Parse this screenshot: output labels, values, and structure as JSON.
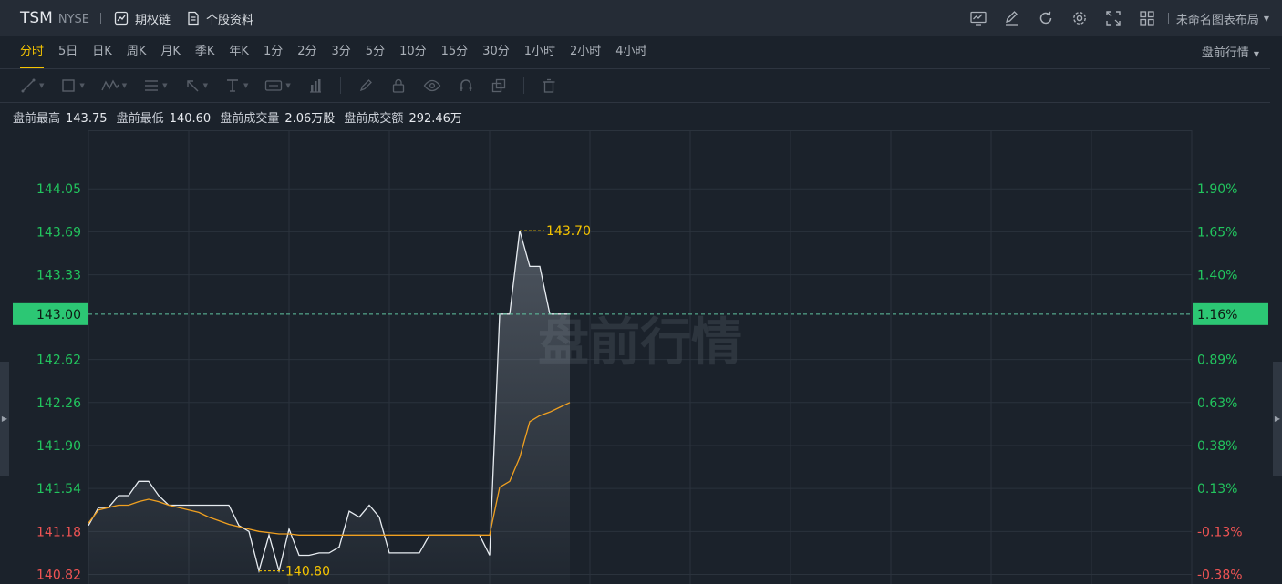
{
  "header": {
    "symbol": "TSM",
    "exchange": "NYSE",
    "btn_options": "期权链",
    "btn_profile": "个股资料",
    "layout_name": "未命名图表布局"
  },
  "header_icons": [
    "indicator-icon",
    "edit-icon",
    "refresh-icon",
    "settings-icon",
    "fullscreen-icon",
    "grid-layout-icon"
  ],
  "periods": [
    "分时",
    "5日",
    "日K",
    "周K",
    "月K",
    "季K",
    "年K",
    "1分",
    "2分",
    "3分",
    "5分",
    "10分",
    "15分",
    "30分",
    "1小时",
    "2小时",
    "4小时"
  ],
  "active_period": "分时",
  "session_label": "盘前行情",
  "draw_tools": [
    "trend-line-icon",
    "rectangle-icon",
    "pattern-icon",
    "fib-icon",
    "arrow-icon",
    "text-icon",
    "price-label-icon",
    "bar-pattern-icon",
    "brush-icon",
    "lock-icon",
    "eye-icon",
    "magnet-icon",
    "clone-icon",
    "trash-icon"
  ],
  "stats": [
    {
      "label": "盘前最高",
      "value": "143.75"
    },
    {
      "label": "盘前最低",
      "value": "140.60"
    },
    {
      "label": "盘前成交量",
      "value": "2.06万股"
    },
    {
      "label": "盘前成交额",
      "value": "292.46万"
    }
  ],
  "colors": {
    "up": "#22c55e",
    "down": "#f05454",
    "current_bg": "#2cc774",
    "price_line": "#e8edf2",
    "avg_line": "#f0a020",
    "annotation": "#f5c400",
    "watermark": "#3a424c"
  },
  "chart_data": {
    "type": "line",
    "watermark": "盘前行情",
    "y_ticks": [
      {
        "price": "144.05",
        "pct": "1.90%",
        "dir": "up"
      },
      {
        "price": "143.69",
        "pct": "1.65%",
        "dir": "up"
      },
      {
        "price": "143.33",
        "pct": "1.40%",
        "dir": "up"
      },
      {
        "price": "142.62",
        "pct": "0.89%",
        "dir": "up"
      },
      {
        "price": "142.26",
        "pct": "0.63%",
        "dir": "up"
      },
      {
        "price": "141.90",
        "pct": "0.38%",
        "dir": "up"
      },
      {
        "price": "141.54",
        "pct": "0.13%",
        "dir": "up"
      },
      {
        "price": "141.18",
        "pct": "-0.13%",
        "dir": "down"
      },
      {
        "price": "140.82",
        "pct": "-0.38%",
        "dir": "down"
      }
    ],
    "y_range": [
      140.74,
      144.54
    ],
    "x_range": [
      0,
      110
    ],
    "current": {
      "price": "143.00",
      "pct": "1.16%"
    },
    "high_label": "143.70",
    "low_label": "140.80",
    "price": {
      "x": [
        0,
        1,
        2,
        3,
        4,
        5,
        6,
        7,
        8,
        9,
        10,
        11,
        12,
        13,
        14,
        15,
        16,
        17,
        18,
        19,
        20,
        21,
        22,
        23,
        24,
        25,
        26,
        27,
        28,
        29,
        30,
        31,
        32,
        33,
        34,
        35,
        36,
        37,
        38,
        39,
        40,
        41,
        42,
        43,
        44,
        45,
        46,
        47,
        48
      ],
      "y": [
        141.23,
        141.38,
        141.38,
        141.48,
        141.48,
        141.6,
        141.6,
        141.48,
        141.4,
        141.4,
        141.4,
        141.4,
        141.4,
        141.4,
        141.4,
        141.23,
        141.18,
        140.85,
        141.15,
        140.85,
        141.2,
        140.98,
        140.98,
        141.0,
        141.0,
        141.05,
        141.35,
        141.3,
        141.4,
        141.3,
        141.0,
        141.0,
        141.0,
        141.0,
        141.15,
        141.15,
        141.15,
        141.15,
        141.15,
        141.15,
        140.98,
        143.0,
        143.0,
        143.7,
        143.4,
        143.4,
        143.0,
        143.0,
        143.0
      ]
    },
    "avg": {
      "x": [
        0,
        1,
        2,
        3,
        4,
        5,
        6,
        7,
        8,
        9,
        10,
        11,
        12,
        13,
        14,
        15,
        16,
        17,
        18,
        19,
        20,
        21,
        22,
        23,
        24,
        25,
        26,
        27,
        28,
        29,
        30,
        31,
        32,
        33,
        34,
        35,
        36,
        37,
        38,
        39,
        40,
        41,
        42,
        43,
        44,
        45,
        46,
        47,
        48
      ],
      "y": [
        141.25,
        141.36,
        141.38,
        141.4,
        141.4,
        141.43,
        141.45,
        141.43,
        141.4,
        141.38,
        141.36,
        141.34,
        141.3,
        141.27,
        141.24,
        141.22,
        141.2,
        141.18,
        141.17,
        141.16,
        141.16,
        141.15,
        141.15,
        141.15,
        141.15,
        141.15,
        141.15,
        141.15,
        141.15,
        141.15,
        141.15,
        141.15,
        141.15,
        141.15,
        141.15,
        141.15,
        141.15,
        141.15,
        141.15,
        141.15,
        141.15,
        141.55,
        141.6,
        141.8,
        142.1,
        142.15,
        142.18,
        142.22,
        142.26
      ]
    }
  }
}
